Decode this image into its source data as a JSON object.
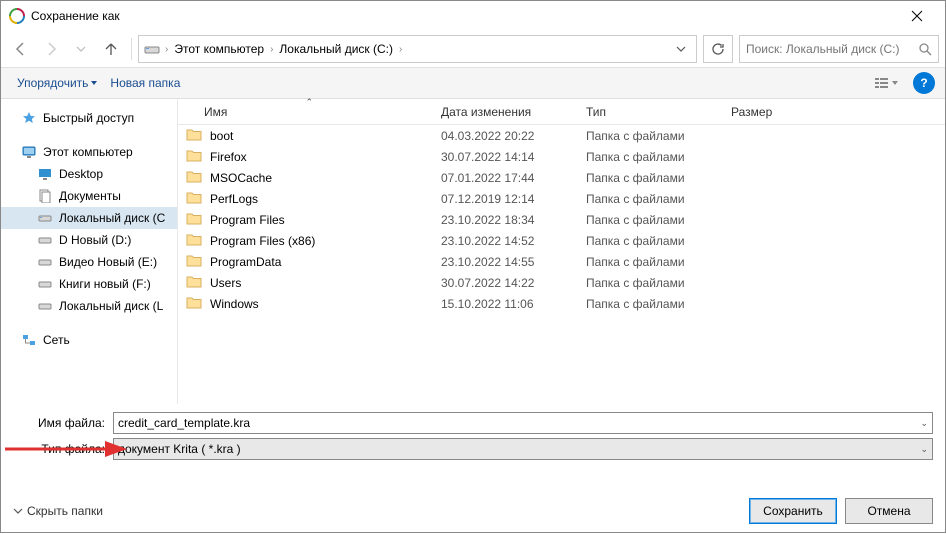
{
  "window": {
    "title": "Сохранение как"
  },
  "breadcrumb": {
    "items": [
      "Этот компьютер",
      "Локальный диск (C:)"
    ]
  },
  "search": {
    "placeholder": "Поиск: Локальный диск (C:)"
  },
  "toolbar": {
    "organize": "Упорядочить",
    "new_folder": "Новая папка"
  },
  "sidebar": {
    "quick_access": "Быстрый доступ",
    "this_pc": "Этот компьютер",
    "desktop": "Desktop",
    "documents": "Документы",
    "local_c": "Локальный диск (C",
    "d_new": "D Новый (D:)",
    "video_new": "Видео Новый (E:)",
    "books_new": "Книги новый (F:)",
    "local_l": "Локальный диск (L",
    "network": "Сеть"
  },
  "columns": {
    "name": "Имя",
    "date": "Дата изменения",
    "type": "Тип",
    "size": "Размер"
  },
  "files": [
    {
      "name": "boot",
      "date": "04.03.2022 20:22",
      "type": "Папка с файлами"
    },
    {
      "name": "Firefox",
      "date": "30.07.2022 14:14",
      "type": "Папка с файлами"
    },
    {
      "name": "MSOCache",
      "date": "07.01.2022 17:44",
      "type": "Папка с файлами"
    },
    {
      "name": "PerfLogs",
      "date": "07.12.2019 12:14",
      "type": "Папка с файлами"
    },
    {
      "name": "Program Files",
      "date": "23.10.2022 18:34",
      "type": "Папка с файлами"
    },
    {
      "name": "Program Files (x86)",
      "date": "23.10.2022 14:52",
      "type": "Папка с файлами"
    },
    {
      "name": "ProgramData",
      "date": "23.10.2022 14:55",
      "type": "Папка с файлами"
    },
    {
      "name": "Users",
      "date": "30.07.2022 14:22",
      "type": "Папка с файлами"
    },
    {
      "name": "Windows",
      "date": "15.10.2022 11:06",
      "type": "Папка с файлами"
    }
  ],
  "form": {
    "filename_label": "Имя файла:",
    "filename_value": "credit_card_template.kra",
    "filetype_label": "Тип файла:",
    "filetype_value": "документ Krita ( *.kra )"
  },
  "footer": {
    "hide_folders": "Скрыть папки",
    "save": "Сохранить",
    "cancel": "Отмена"
  }
}
